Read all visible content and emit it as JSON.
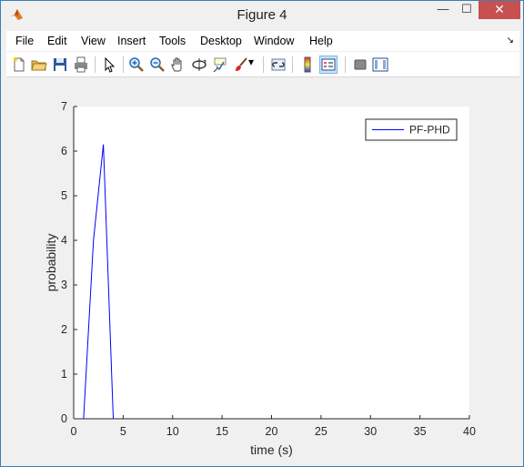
{
  "window": {
    "title": "Figure 4",
    "minimize_glyph": "—",
    "maximize_glyph": "☐",
    "close_glyph": "✕"
  },
  "menu": {
    "items": [
      {
        "label": "File"
      },
      {
        "label": "Edit"
      },
      {
        "label": "View"
      },
      {
        "label": "Insert"
      },
      {
        "label": "Tools"
      },
      {
        "label": "Desktop"
      },
      {
        "label": "Window"
      },
      {
        "label": "Help"
      }
    ],
    "dock_glyph": "↘"
  },
  "toolbar": {
    "buttons": [
      {
        "icon": "new-figure-icon"
      },
      {
        "icon": "open-file-icon"
      },
      {
        "icon": "save-icon"
      },
      {
        "icon": "print-icon"
      },
      {
        "icon": "edit-plot-arrow-icon"
      },
      {
        "icon": "zoom-in-icon"
      },
      {
        "icon": "zoom-out-icon"
      },
      {
        "icon": "pan-hand-icon"
      },
      {
        "icon": "rotate-3d-icon"
      },
      {
        "icon": "data-cursor-icon"
      },
      {
        "icon": "brush-icon"
      },
      {
        "icon": "link-plot-icon"
      },
      {
        "icon": "insert-colorbar-icon"
      },
      {
        "icon": "insert-legend-icon"
      },
      {
        "icon": "hide-plot-tools-icon"
      },
      {
        "icon": "show-plot-tools-icon"
      }
    ],
    "brush_dropdown_glyph": "▾"
  },
  "chart_data": {
    "type": "line",
    "title": "",
    "xlabel": "time (s)",
    "ylabel": "probability",
    "xlim": [
      0,
      40
    ],
    "ylim": [
      0,
      7
    ],
    "xticks": [
      0,
      5,
      10,
      15,
      20,
      25,
      30,
      35,
      40
    ],
    "yticks": [
      0,
      1,
      2,
      3,
      4,
      5,
      6,
      7
    ],
    "grid": false,
    "legend_position": "top-right",
    "series": [
      {
        "name": "PF-PHD",
        "color": "#0000ff",
        "x": [
          1,
          2,
          3,
          4,
          5,
          40
        ],
        "y": [
          0,
          4.0,
          6.15,
          0,
          0,
          0
        ]
      }
    ]
  }
}
